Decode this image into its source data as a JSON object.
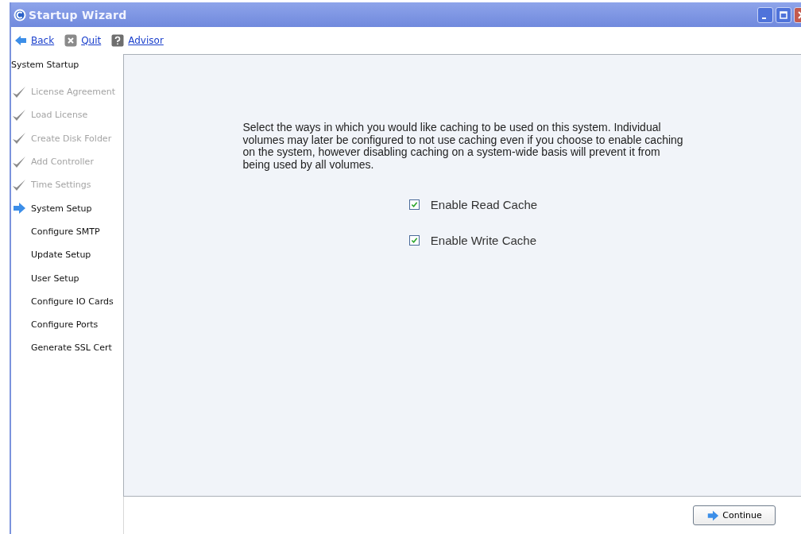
{
  "window": {
    "title": "Startup Wizard"
  },
  "toolbar": [
    {
      "kind": "back",
      "label": "Back"
    },
    {
      "kind": "quit",
      "label": "Quit"
    },
    {
      "kind": "help",
      "label": "Advisor"
    }
  ],
  "sidebar": {
    "heading": "System Startup",
    "items": [
      {
        "label": "License Agreement",
        "completed": true,
        "selected": false
      },
      {
        "label": "Load License",
        "completed": true,
        "selected": false
      },
      {
        "label": "Create Disk Folder",
        "completed": true,
        "selected": false
      },
      {
        "label": "Add Controller",
        "completed": true,
        "selected": false
      },
      {
        "label": "Time Settings",
        "completed": true,
        "selected": false
      },
      {
        "label": "System Setup",
        "completed": false,
        "selected": true
      },
      {
        "label": "Configure SMTP",
        "completed": false,
        "selected": false
      },
      {
        "label": "Update Setup",
        "completed": false,
        "selected": false
      },
      {
        "label": "User Setup",
        "completed": false,
        "selected": false
      },
      {
        "label": "Configure IO Cards",
        "completed": false,
        "selected": false
      },
      {
        "label": "Configure Ports",
        "completed": false,
        "selected": false
      },
      {
        "label": "Generate SSL Cert",
        "completed": false,
        "selected": false
      }
    ]
  },
  "content": {
    "description": "Select the ways in which you would like caching to be used on this system. Individual volumes may later be configured to not use caching even if you choose to enable caching on the system, however disabling caching on a system-wide basis will prevent it from being used by all volumes.",
    "options": [
      {
        "label": "Enable Read Cache",
        "checked": true
      },
      {
        "label": "Enable Write Cache",
        "checked": true
      }
    ]
  },
  "footer": {
    "button": "Continue"
  }
}
